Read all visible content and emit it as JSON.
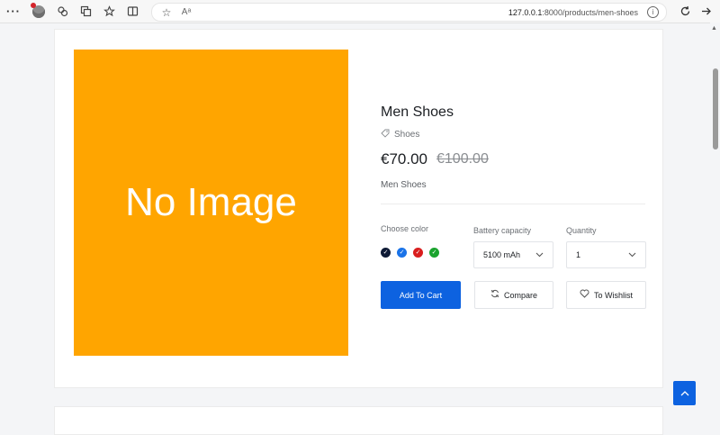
{
  "browser": {
    "url_host": "127.0.0.1",
    "url_path": ":8000/products/men-shoes",
    "reader_label": "Aᵃ"
  },
  "product": {
    "image_placeholder": "No Image",
    "title": "Men Shoes",
    "category": "Shoes",
    "price": "€70.00",
    "old_price": "€100.00",
    "description": "Men Shoes"
  },
  "options": {
    "color_label": "Choose color",
    "colors": [
      "#0e1a35",
      "#1a73e8",
      "#d91e1e",
      "#1aa32e"
    ],
    "battery_label": "Battery capacity",
    "battery_value": "5100 mAh",
    "quantity_label": "Quantity",
    "quantity_value": "1"
  },
  "actions": {
    "add_to_cart": "Add To Cart",
    "compare": "Compare",
    "wishlist": "To Wishlist"
  }
}
